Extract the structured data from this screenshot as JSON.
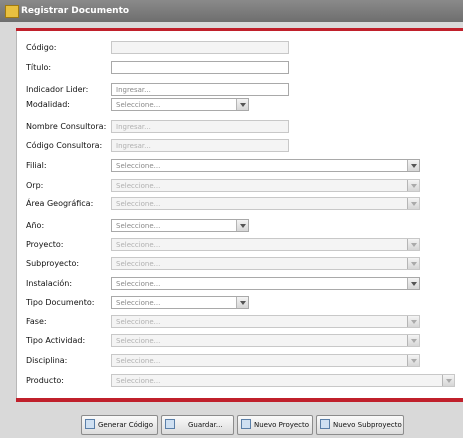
{
  "window": {
    "title": "Registrar Documento",
    "icon": "folder-icon"
  },
  "form": {
    "fields": [
      {
        "label": "Código:",
        "placeholder": "",
        "enabled": false
      },
      {
        "label": "Título:",
        "placeholder": "",
        "enabled": true
      },
      {
        "label": "Indicador Lider:",
        "placeholder": "Ingresar...",
        "enabled": true
      },
      {
        "label": "Modalidad:",
        "placeholder": "Seleccione...",
        "enabled": true
      },
      {
        "label": "Nombre Consultora:",
        "placeholder": "Ingresar...",
        "enabled": false
      },
      {
        "label": "Código Consultora:",
        "placeholder": "Ingresar...",
        "enabled": false
      },
      {
        "label": "Filial:",
        "placeholder": "Seleccione...",
        "enabled": true
      },
      {
        "label": "Orp:",
        "placeholder": "Seleccione...",
        "enabled": false
      },
      {
        "label": "Área Geográfica:",
        "placeholder": "Seleccione...",
        "enabled": false
      },
      {
        "label": "Año:",
        "placeholder": "Seleccione...",
        "enabled": true
      },
      {
        "label": "Proyecto:",
        "placeholder": "Seleccione...",
        "enabled": false
      },
      {
        "label": "Subproyecto:",
        "placeholder": "Seleccione...",
        "enabled": false
      },
      {
        "label": "Instalación:",
        "placeholder": "Seleccione...",
        "enabled": true
      },
      {
        "label": "Tipo Documento:",
        "placeholder": "Seleccione...",
        "enabled": true
      },
      {
        "label": "Fase:",
        "placeholder": "Seleccione...",
        "enabled": false
      },
      {
        "label": "Tipo Actividad:",
        "placeholder": "Seleccione...",
        "enabled": false
      },
      {
        "label": "Disciplina:",
        "placeholder": "Seleccione...",
        "enabled": false
      },
      {
        "label": "Producto:",
        "placeholder": "Seleccione...",
        "enabled": false
      }
    ]
  },
  "buttons": {
    "generar_codigo": "Generar Código",
    "guardar": "Guardar...",
    "nuevo_proyecto": "Nuevo Proyecto",
    "nuevo_subproyecto": "Nuevo Subproyecto"
  }
}
